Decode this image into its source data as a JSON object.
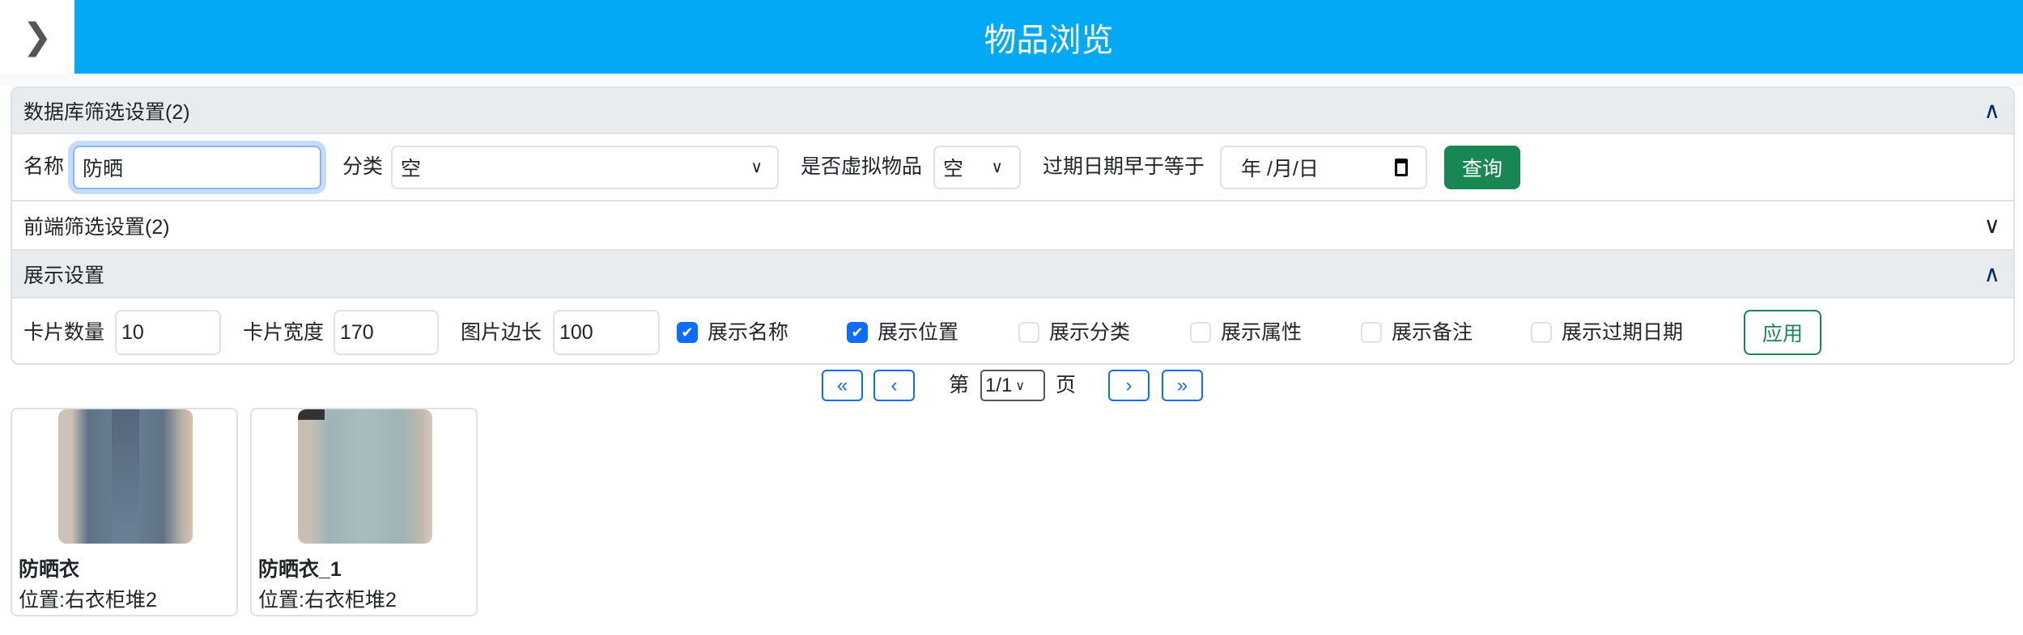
{
  "header": {
    "title": "物品浏览",
    "toggle_icon": "chevron-right-icon",
    "color": "#03a9f4"
  },
  "db_filter": {
    "title": "数据库筛选设置(2)",
    "expanded": true,
    "name_label": "名称",
    "name_value": "防晒",
    "category_label": "分类",
    "category_value": "空",
    "virtual_label": "是否虚拟物品",
    "virtual_value": "空",
    "expire_label": "过期日期早于等于",
    "expire_placeholder": "年 /月/日",
    "query_label": "查询",
    "query_color": "#198754"
  },
  "fe_filter": {
    "title": "前端筛选设置(2)",
    "expanded": false
  },
  "display": {
    "title": "展示设置",
    "expanded": true,
    "card_count_label": "卡片数量",
    "card_count": "10",
    "card_width_label": "卡片宽度",
    "card_width": "170",
    "img_size_label": "图片边长",
    "img_size": "100",
    "checks": [
      {
        "label": "展示名称",
        "checked": true
      },
      {
        "label": "展示位置",
        "checked": true
      },
      {
        "label": "展示分类",
        "checked": false
      },
      {
        "label": "展示属性",
        "checked": false
      },
      {
        "label": "展示备注",
        "checked": false
      },
      {
        "label": "展示过期日期",
        "checked": false
      }
    ],
    "apply_label": "应用"
  },
  "pagination": {
    "first": "«",
    "prev": "‹",
    "prefix": "第",
    "page": "1/1",
    "suffix": "页",
    "next": "›",
    "last": "»"
  },
  "items": [
    {
      "name": "防晒衣",
      "location": "位置:右衣柜堆2"
    },
    {
      "name": "防晒衣_1",
      "location": "位置:右衣柜堆2"
    }
  ]
}
